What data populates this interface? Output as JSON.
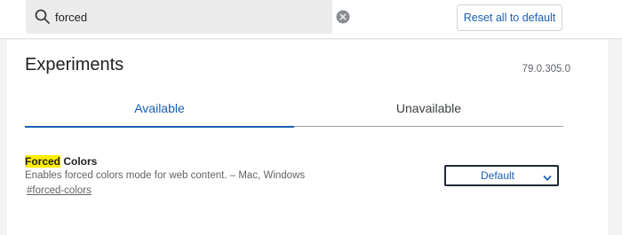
{
  "search": {
    "value": "forced",
    "icon": "search-icon",
    "clear_icon": "close-circle-icon"
  },
  "header": {
    "reset_label": "Reset all to default"
  },
  "page": {
    "title": "Experiments",
    "version": "79.0.305.0"
  },
  "tabs": [
    {
      "label": "Available",
      "active": true
    },
    {
      "label": "Unavailable",
      "active": false
    }
  ],
  "experiment": {
    "name_highlight": "Forced",
    "name_rest": " Colors",
    "description": "Enables forced colors mode for web content. – Mac, Windows",
    "link": "#forced-colors",
    "selected_option": "Default"
  },
  "colors": {
    "accent": "#1a5fb4",
    "highlight": "#ffef00",
    "page_bg": "#f3f3f3"
  }
}
